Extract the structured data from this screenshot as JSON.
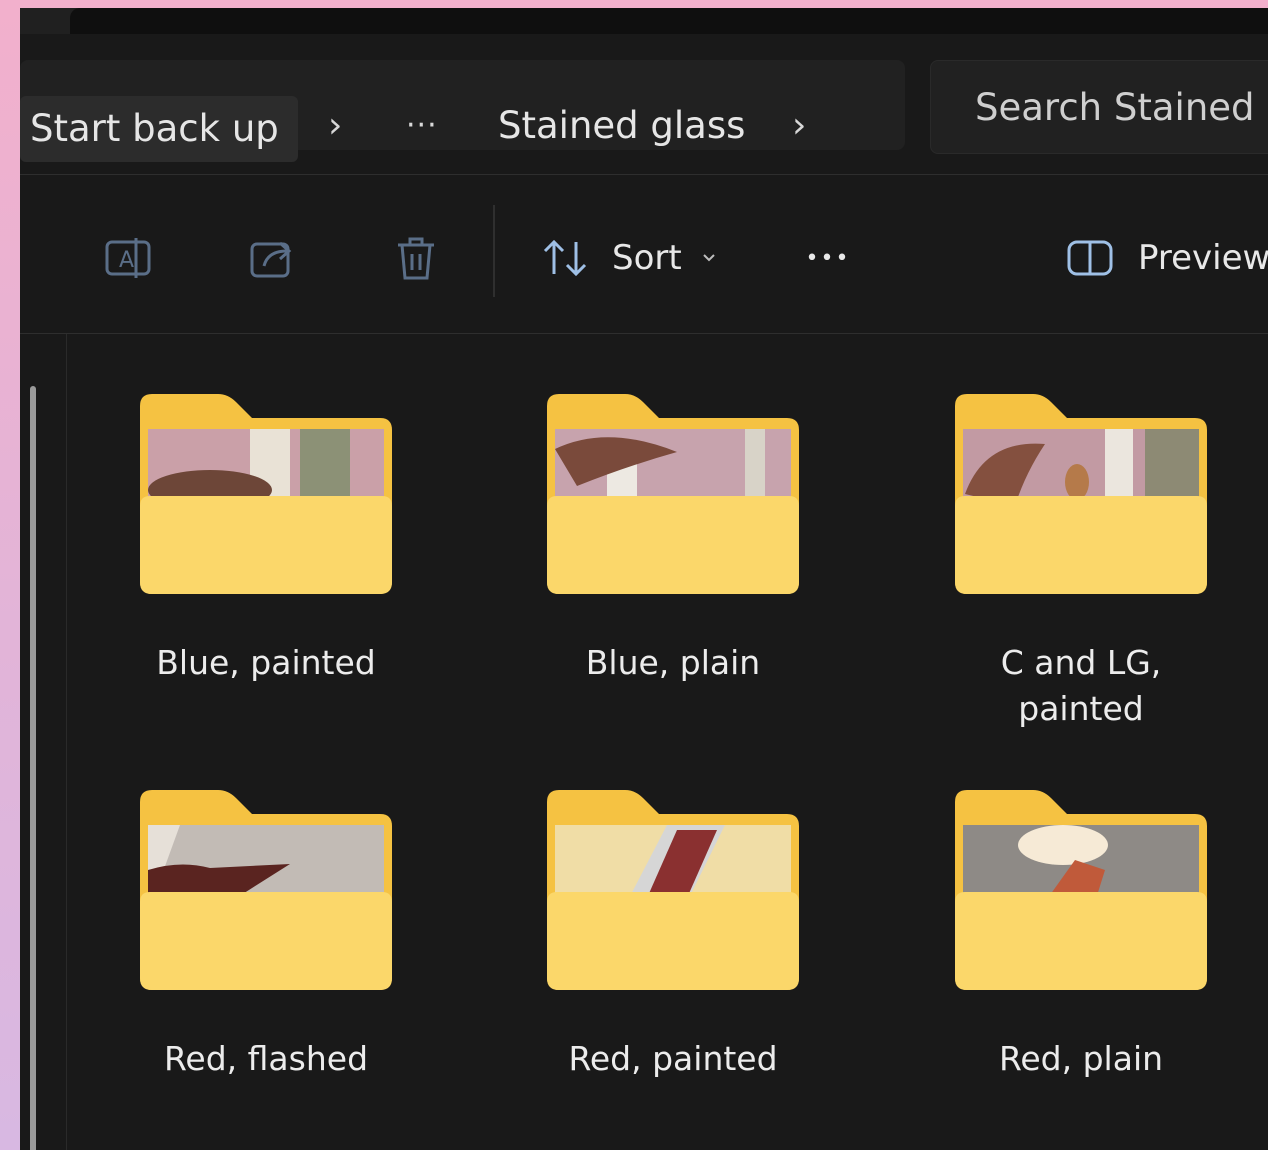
{
  "breadcrumb": {
    "start": "Start back up",
    "sep": "›",
    "ellipsis": "···",
    "current": "Stained glass",
    "sep2": "›"
  },
  "search": {
    "placeholder": "Search Stained glass"
  },
  "toolbar": {
    "rename_icon": "rename-icon",
    "share_icon": "share-icon",
    "delete_icon": "delete-icon",
    "sort_label": "Sort",
    "more_label": "•••",
    "preview_label": "Preview"
  },
  "folders": [
    {
      "name": "Blue, painted"
    },
    {
      "name": "Blue, plain"
    },
    {
      "name": "C and LG, painted"
    },
    {
      "name": "Red, flashed"
    },
    {
      "name": "Red, painted"
    },
    {
      "name": "Red, plain"
    }
  ],
  "colors": {
    "window_bg": "#191919",
    "folder_yellow": "#fbd76a",
    "folder_tab": "#f5c242",
    "text": "#e6e6e6"
  }
}
